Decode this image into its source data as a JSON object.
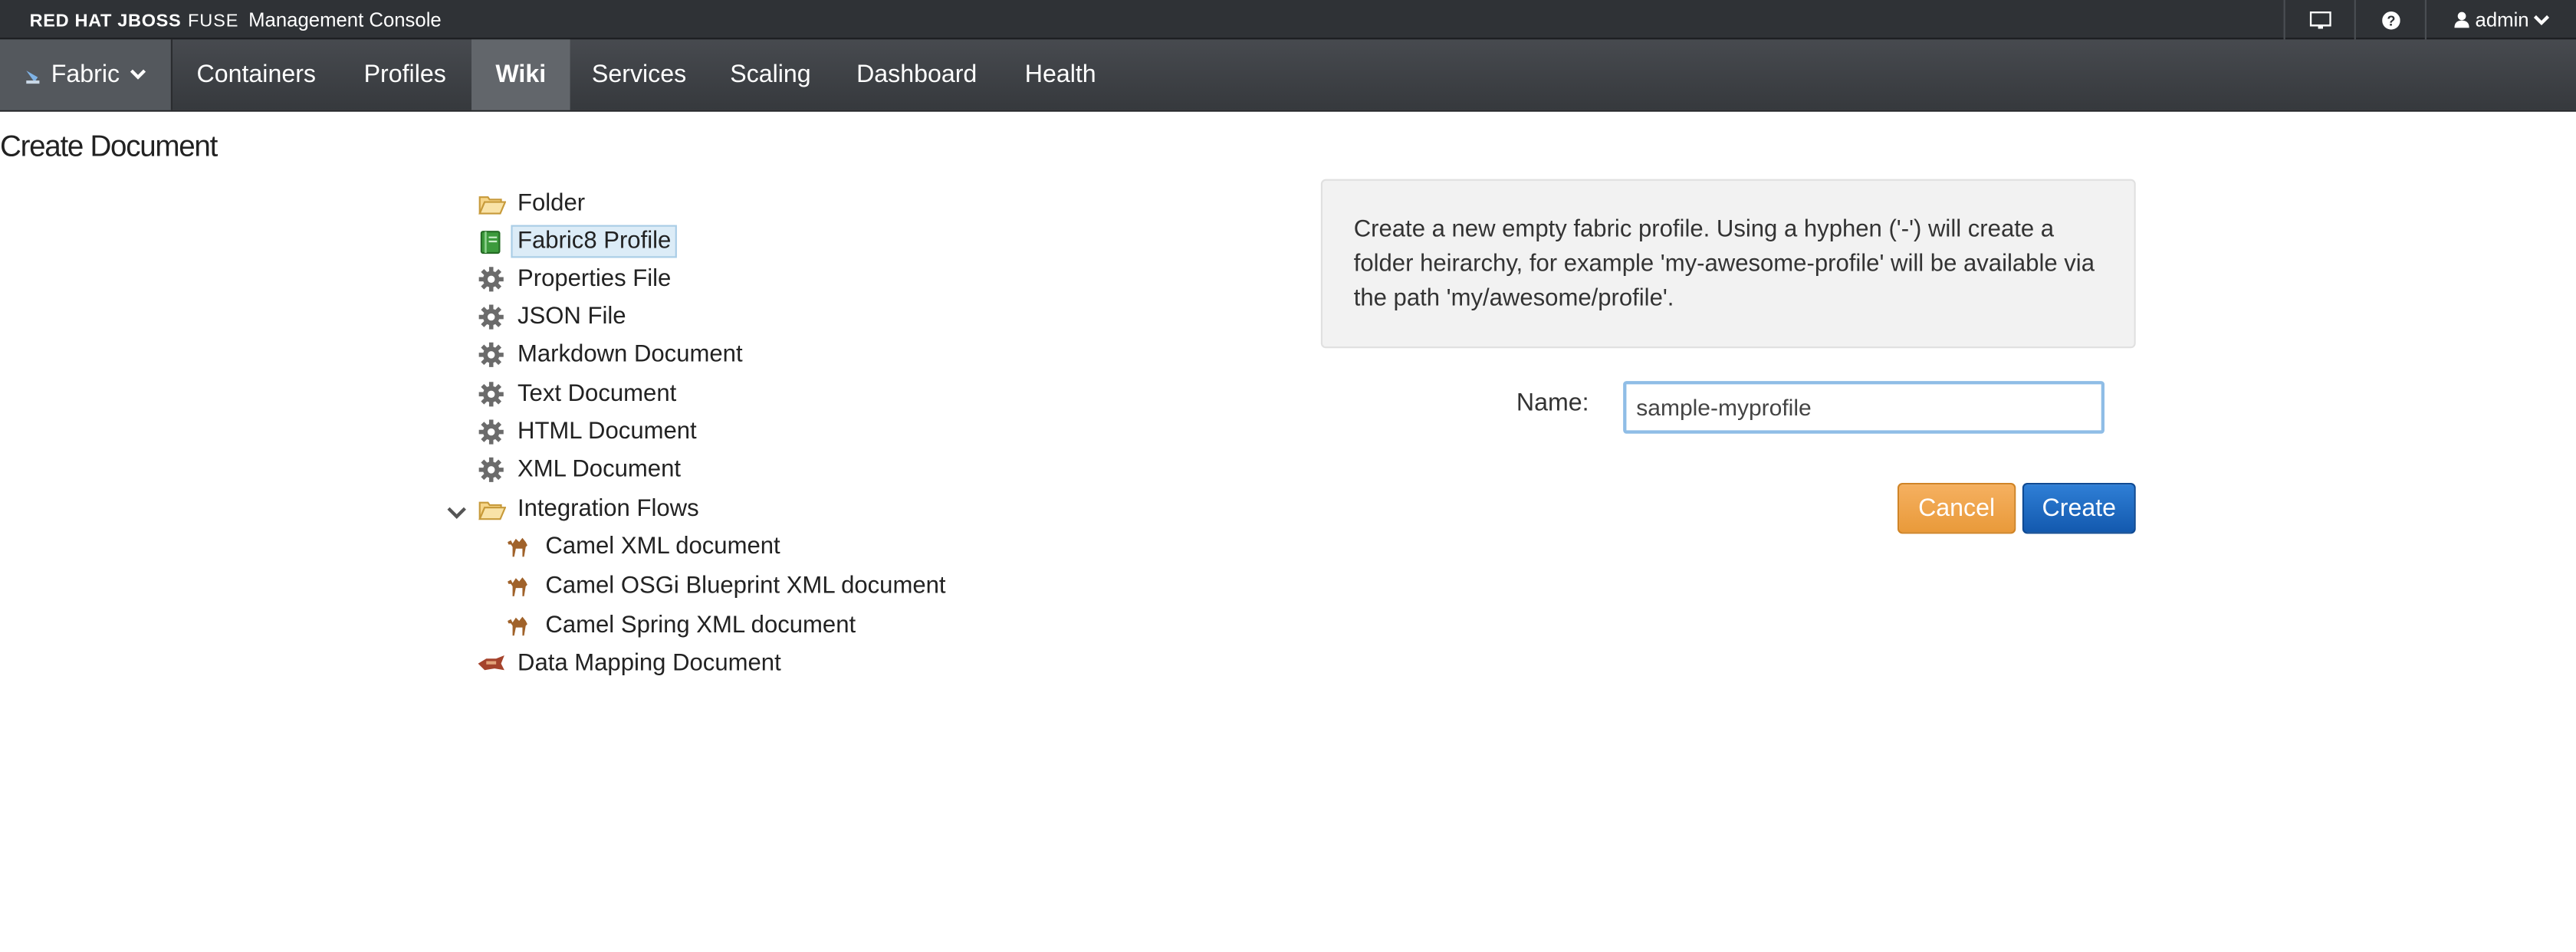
{
  "brand": {
    "product_strong": "RED HAT JBOSS",
    "product_fuse": "FUSE",
    "console_label": "Management Console"
  },
  "utility": {
    "user_label": "admin"
  },
  "nav": {
    "fabric_label": "Fabric",
    "items": [
      "Containers",
      "Profiles",
      "Wiki",
      "Services",
      "Scaling",
      "Dashboard",
      "Health"
    ],
    "active": "Wiki"
  },
  "page": {
    "title": "Create Document"
  },
  "tree": {
    "items": [
      {
        "label": "Folder",
        "icon": "folder-open-icon"
      },
      {
        "label": "Fabric8 Profile",
        "icon": "book-icon",
        "selected": true
      },
      {
        "label": "Properties File",
        "icon": "gear-icon"
      },
      {
        "label": "JSON File",
        "icon": "gear-icon"
      },
      {
        "label": "Markdown Document",
        "icon": "gear-icon"
      },
      {
        "label": "Text Document",
        "icon": "gear-icon"
      },
      {
        "label": "HTML Document",
        "icon": "gear-icon"
      },
      {
        "label": "XML Document",
        "icon": "gear-icon"
      },
      {
        "label": "Integration Flows",
        "icon": "folder-open-icon",
        "expanded": true
      },
      {
        "label": "Camel XML document",
        "icon": "camel-icon"
      },
      {
        "label": "Camel OSGi Blueprint XML document",
        "icon": "camel-icon"
      },
      {
        "label": "Camel Spring XML document",
        "icon": "camel-icon"
      },
      {
        "label": "Data Mapping Document",
        "icon": "data-mapper-icon"
      }
    ]
  },
  "form": {
    "description": "Create a new empty fabric profile. Using a hyphen ('-') will create a folder heirarchy, for example 'my-awesome-profile' will be available via the path 'my/awesome/profile'.",
    "name_label": "Name:",
    "name_value": "sample-myprofile",
    "cancel_label": "Cancel",
    "create_label": "Create"
  },
  "colors": {
    "banner_bg": "#2f3236",
    "nav_bg": "#3b3e42",
    "nav_active_bg": "#62666b",
    "cancel_button": "#f0a64c",
    "create_button": "#1f6bc4",
    "selection_bg": "#dcecf7"
  }
}
